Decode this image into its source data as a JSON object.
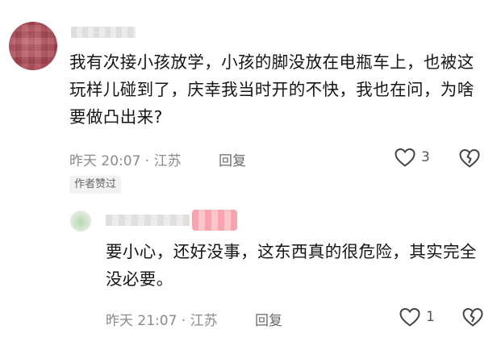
{
  "comments": [
    {
      "text": "我有次接小孩放学，小孩的脚没放在电瓶车上，也被这玩样儿碰到了，庆幸我当时开的不快，我也在问，为啥要做凸出来?",
      "meta": "昨天 20:07 · 江苏",
      "reply_label": "回复",
      "like_count": "3",
      "badge": "作者赞过"
    },
    {
      "text": "要小心，还好没事，这东西真的很危险，其实完全没必要。",
      "meta": "昨天 21:07 · 江苏",
      "reply_label": "回复",
      "like_count": "1"
    }
  ],
  "icons": {
    "like": "heart-outline-icon",
    "dislike": "broken-heart-icon"
  },
  "colors": {
    "text": "#151515",
    "meta": "#8a8a8a",
    "badge_bg": "#f2f2f2",
    "icon": "#444444"
  }
}
